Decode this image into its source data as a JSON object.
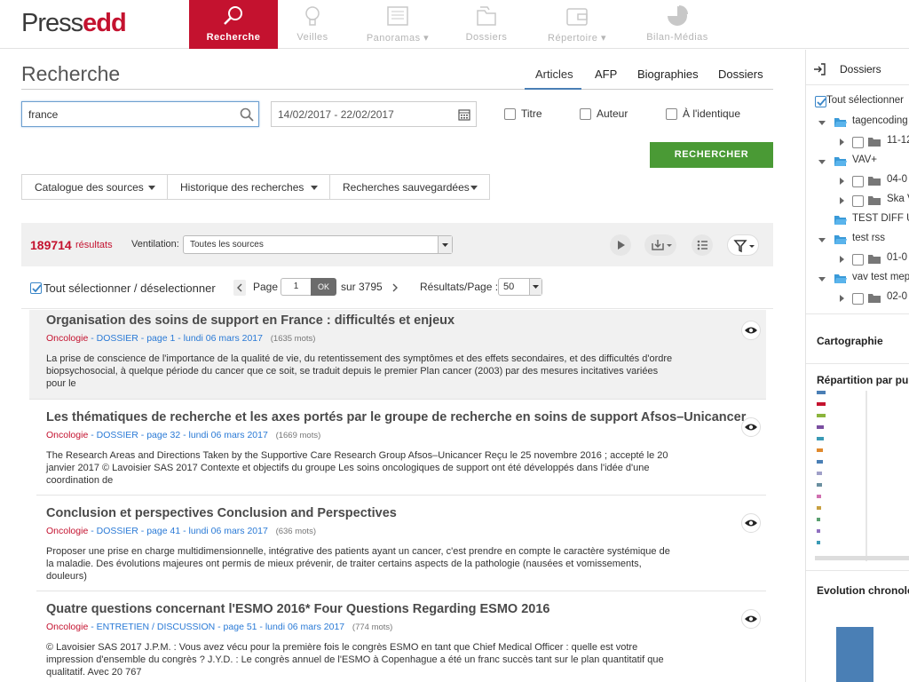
{
  "logo": {
    "part1": "Press",
    "part2": "edd"
  },
  "nav": [
    {
      "label": "Recherche",
      "icon": "search-icon",
      "active": true
    },
    {
      "label": "Veilles",
      "icon": "lightbulb-icon"
    },
    {
      "label": "Panoramas",
      "icon": "newspaper-icon",
      "dropdown": true
    },
    {
      "label": "Dossiers",
      "icon": "folder-stack-icon"
    },
    {
      "label": "Répertoire",
      "icon": "wallet-icon",
      "dropdown": true
    },
    {
      "label": "Bilan-Médias",
      "icon": "pie-chart-icon"
    }
  ],
  "page_title": "Recherche",
  "tabs": [
    "Articles",
    "AFP",
    "Biographies",
    "Dossiers"
  ],
  "search": {
    "value": "france",
    "date_range": "14/02/2017 - 22/02/2017"
  },
  "options": [
    "Titre",
    "Auteur",
    "À l'identique"
  ],
  "search_button": "RECHERCHER",
  "dropdowns": [
    "Catalogue des sources",
    "Historique des recherches",
    "Recherches sauvegardées"
  ],
  "results": {
    "count": "189714",
    "count_label": "résultats",
    "ventilation_label": "Ventilation:",
    "ventilation_value": "Toutes les sources"
  },
  "pagination": {
    "select_all": "Tout sélectionner / déselectionner",
    "page_label": "Page :",
    "page": "1",
    "ok": "OK",
    "total": "sur 3795",
    "per_page_label": "Résultats/Page :",
    "per_page": "50"
  },
  "articles": [
    {
      "title": "Organisation des soins de support en France : difficultés et enjeux",
      "category": "Oncologie",
      "source": "DOSSIER - page 1 - lundi 06 mars 2017",
      "words": "(1635 mots)",
      "snippet": "La prise de conscience de l'importance de la qualité de vie, du retentissement des symptômes et des effets secondaires, et des difficultés d'ordre biopsychosocial, à quelque période du cancer que ce soit, se traduit depuis le premier Plan cancer (2003) par des mesures incitatives variées pour le"
    },
    {
      "title": "Les thématiques de recherche et les axes portés par le groupe de recherche en soins de support Afsos–Unicancer",
      "category": "Oncologie",
      "source": "DOSSIER - page 32 - lundi 06 mars 2017",
      "words": "(1669 mots)",
      "snippet": "The Research Areas and Directions Taken by the Supportive Care Research Group Afsos–Unicancer Reçu le 25 novembre 2016 ; accepté le 20 janvier 2017 © Lavoisier SAS 2017 Contexte et objectifs du groupe Les soins oncologiques de support ont été développés dans l'idée d'une coordination de"
    },
    {
      "title": "Conclusion et perspectives Conclusion and Perspectives",
      "category": "Oncologie",
      "source": "DOSSIER - page 41 - lundi 06 mars 2017",
      "words": "(636 mots)",
      "snippet": "Proposer une prise en charge multidimensionnelle, intégrative des patients ayant un cancer, c'est prendre en compte le caractère systémique de la maladie. Des évolutions majeures ont permis de mieux prévenir, de traiter certains aspects de la pathologie (nausées et vomissements, douleurs)"
    },
    {
      "title": "Quatre questions concernant l'ESMO 2016* Four Questions Regarding ESMO 2016",
      "category": "Oncologie",
      "source": "ENTRETIEN / DISCUSSION - page 51 - lundi 06 mars 2017",
      "words": "(774 mots)",
      "snippet": "© Lavoisier SAS 2017 J.P.M. : Vous avez vécu pour la première fois le congrès ESMO en tant que Chief Medical Officer : quelle est votre impression d'ensemble du congrès ? J.Y.D. : Le congrès annuel de l'ESMO à Copenhague a été un franc succès tant sur le plan quantitatif que qualitatif. Avec 20 767"
    }
  ],
  "right_panel": {
    "title": "Dossiers",
    "select_all": "Tout sélectionner",
    "tree": [
      {
        "label": "tagencoding",
        "level": 0
      },
      {
        "label": "11-12-",
        "level": 1
      },
      {
        "label": "VAV+",
        "level": 0
      },
      {
        "label": "04-0",
        "level": 1
      },
      {
        "label": "Ska V",
        "level": 1
      },
      {
        "label": "TEST DIFF U",
        "level": 0
      },
      {
        "label": "test rss",
        "level": 0
      },
      {
        "label": "01-0",
        "level": 1
      },
      {
        "label": "vav test mep",
        "level": 0
      },
      {
        "label": "02-0",
        "level": 1
      }
    ],
    "cartographie": "Cartographie",
    "repartition": "Répartition par publ",
    "evolution": "Evolution chronolog"
  },
  "colors": {
    "brand": "#c4122f",
    "button_green": "#4a9a35",
    "link_blue": "#2a7ad6"
  }
}
